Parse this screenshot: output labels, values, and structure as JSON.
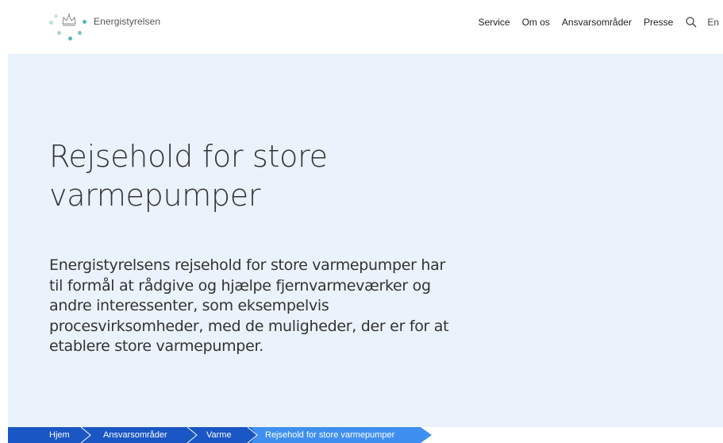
{
  "header": {
    "logo_text": "Energistyrelsen",
    "nav": [
      "Service",
      "Om os",
      "Ansvarsområder",
      "Presse"
    ],
    "search_icon": "search-icon",
    "lang": "En"
  },
  "hero": {
    "title_line1": "Rejsehold for store",
    "title_line2": "varmepumper",
    "lead": "Energistyrelsens rejsehold for store varmepumper har til formål at rådgive og hjælpe fjernvarmeværker og andre interessenter, som eksempelvis procesvirksomheder, med de muligheder, der er for at etablere store varmepumper."
  },
  "breadcrumb": {
    "items": [
      "Hjem",
      "Ansvarsområder",
      "Varme",
      "Rejsehold for store varmepumper"
    ]
  },
  "colors": {
    "hero_bg": "#eaf2fb",
    "breadcrumb_dark": "#1a56c4",
    "breadcrumb_active": "#3f8ff0",
    "logo_teal": "#5bb6b8",
    "logo_blue": "#2e6fb4"
  }
}
